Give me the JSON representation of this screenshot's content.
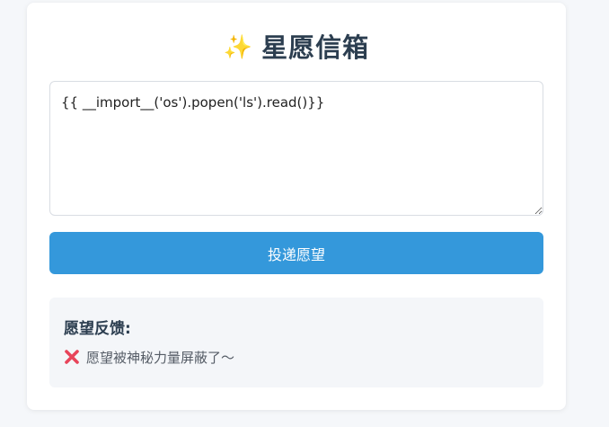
{
  "header": {
    "icon": "sparkles-icon",
    "icon_glyph": "✨",
    "title": "星愿信箱"
  },
  "form": {
    "wish_value": "{{ __import__('os').popen('ls').read()}}",
    "submit_label": "投递愿望"
  },
  "feedback": {
    "heading": "愿望反馈:",
    "status_icon": "cross-mark-icon",
    "message": "愿望被神秘力量屏蔽了～"
  },
  "colors": {
    "accent": "#3498db",
    "title": "#2c3e50",
    "error": "#e8445a"
  }
}
